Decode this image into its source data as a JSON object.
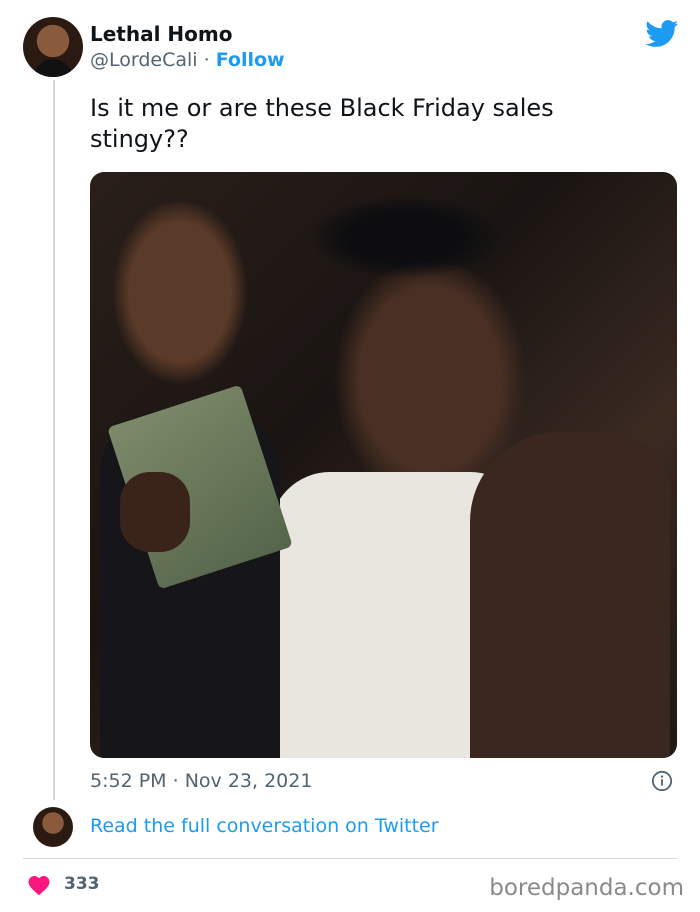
{
  "tweet": {
    "display_name": "Lethal Homo",
    "handle": "@LordeCali",
    "separator": "·",
    "follow_label": "Follow",
    "text": "Is it me or are these Black Friday sales stingy??",
    "time": "5:52 PM",
    "date": "Nov 23, 2021",
    "read_more_label": "Read the full conversation on Twitter",
    "likes": "333"
  },
  "watermark": "boredpanda.com",
  "colors": {
    "accent": "#1d9bf0",
    "text": "#0f1419",
    "secondary": "#536471",
    "like": "#f91880"
  },
  "icons": {
    "brand": "twitter-bird-icon",
    "info": "info-icon",
    "like": "heart-icon"
  }
}
